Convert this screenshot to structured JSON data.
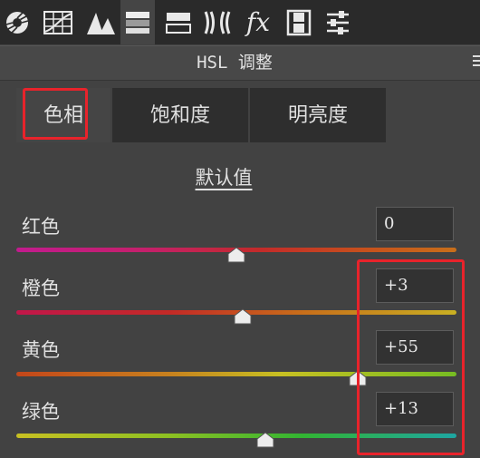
{
  "toolbar": {
    "tools": [
      {
        "icon": "aperture-icon",
        "active": false
      },
      {
        "icon": "tone-curve-grid-icon",
        "active": false
      },
      {
        "icon": "detail-triangles-icon",
        "active": false
      },
      {
        "icon": "hsl-gradient-icon",
        "active": true
      },
      {
        "icon": "split-toning-icon",
        "active": false
      },
      {
        "icon": "lens-correction-icon",
        "active": false
      },
      {
        "icon": "fx-effects-icon",
        "active": false
      },
      {
        "icon": "film-strip-icon",
        "active": false
      },
      {
        "icon": "sliders-icon",
        "active": false
      }
    ],
    "fx_label": "fx"
  },
  "panel": {
    "title": "HSL 调整"
  },
  "tabs": [
    {
      "label": "色相",
      "selected": true
    },
    {
      "label": "饱和度",
      "selected": false
    },
    {
      "label": "明亮度",
      "selected": false
    }
  ],
  "default_link": "默认值",
  "colors": [
    {
      "label": "红色",
      "value": "0",
      "slider_fraction": 0.5
    },
    {
      "label": "橙色",
      "value": "+3",
      "slider_fraction": 0.515
    },
    {
      "label": "黄色",
      "value": "+55",
      "slider_fraction": 0.775
    },
    {
      "label": "绿色",
      "value": "+13",
      "slider_fraction": 0.565
    }
  ],
  "accent": "#e8232b"
}
